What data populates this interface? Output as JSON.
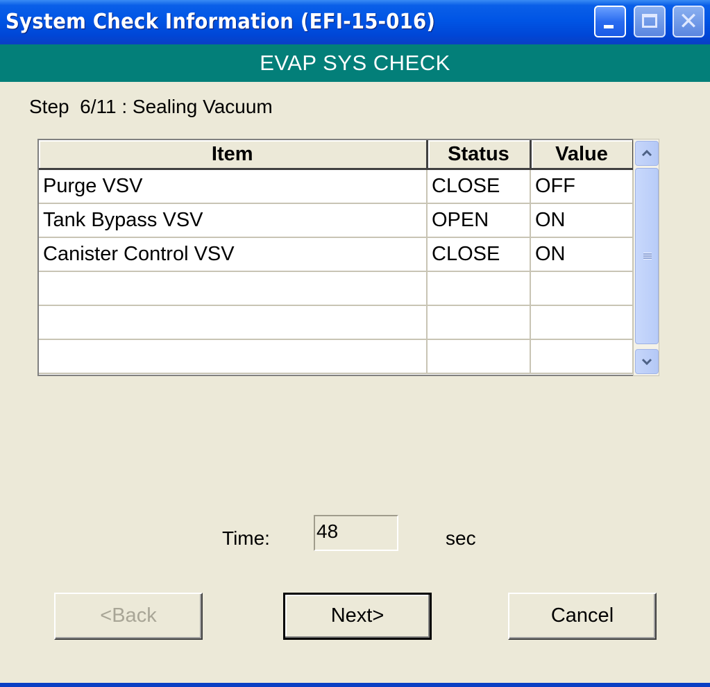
{
  "window": {
    "title": "System Check Information (EFI-15-016)",
    "controls": {
      "minimize": "minimize",
      "maximize": "maximize",
      "close": "close"
    }
  },
  "header": {
    "title": "EVAP SYS CHECK"
  },
  "step": {
    "text": "Step  6/11 : Sealing Vacuum"
  },
  "table": {
    "columns": [
      "Item",
      "Status",
      "Value"
    ],
    "rows": [
      {
        "item": "Purge VSV",
        "status": "CLOSE",
        "value": "OFF"
      },
      {
        "item": "Tank Bypass VSV",
        "status": "OPEN",
        "value": "ON"
      },
      {
        "item": "Canister Control VSV",
        "status": "CLOSE",
        "value": "ON"
      },
      {
        "item": "",
        "status": "",
        "value": ""
      },
      {
        "item": "",
        "status": "",
        "value": ""
      },
      {
        "item": "",
        "status": "",
        "value": ""
      }
    ]
  },
  "timer": {
    "label": "Time:",
    "value": "48",
    "unit": "sec"
  },
  "buttons": {
    "back": "<Back",
    "next": "Next>",
    "cancel": "Cancel"
  },
  "colors": {
    "titlebar": "#0055e5",
    "header_band": "#037f79",
    "dialog_bg": "#ece9d8"
  }
}
